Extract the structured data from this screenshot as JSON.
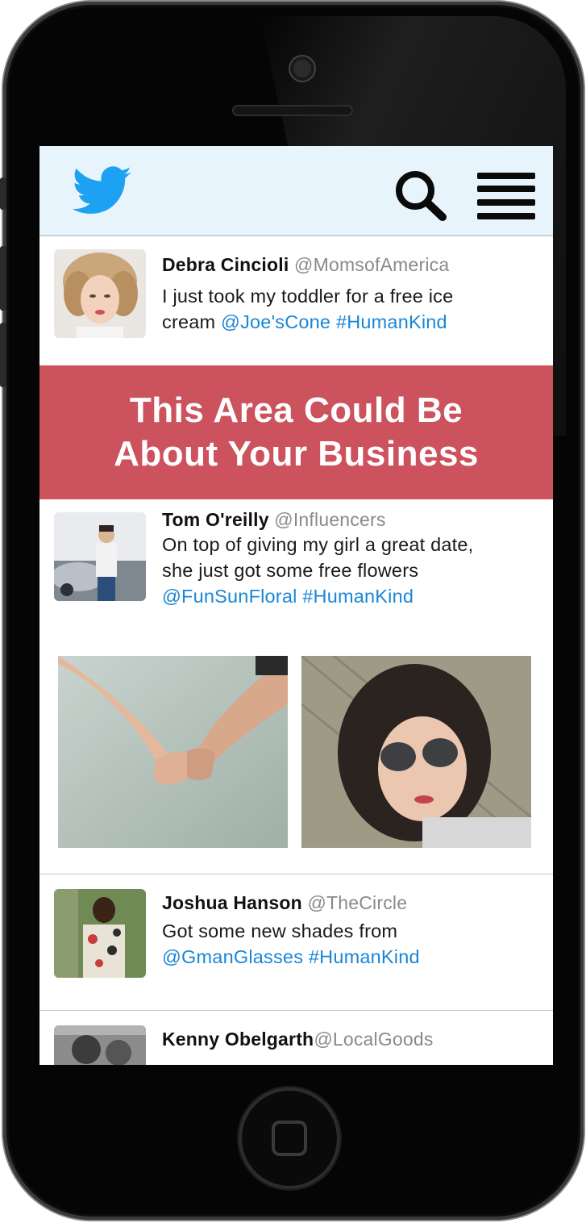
{
  "app": {
    "brand": "twitter",
    "icons": {
      "logo": "twitter-bird-icon",
      "search": "search-icon",
      "menu": "hamburger-menu-icon"
    },
    "colors": {
      "brand_blue": "#1da1f2",
      "header_bg": "#e8f4fb",
      "promo_bg": "#cc525e",
      "link": "#1a86d6",
      "handle": "#8a8a8a"
    }
  },
  "promo": {
    "line1": "This Area Could Be",
    "line2": "About Your Business"
  },
  "tweets": [
    {
      "name": "Debra Cincioli",
      "handle": "@MomsofAmerica",
      "text_line1": "I just took my toddler for a free ice",
      "text_line2_plain": "cream ",
      "mention": "@Joe'sCone",
      "hashtag": "#HumanKind"
    },
    {
      "name": "Tom O'reilly",
      "handle": "@Influencers",
      "text_line1": "On top of giving my girl a great date,",
      "text_line2": "she just got some free flowers",
      "mention": "@FunSunFloral",
      "hashtag": "#HumanKind"
    },
    {
      "name": "Joshua Hanson",
      "handle": "@TheCircle",
      "text_line1": "Got some new shades from",
      "mention": "@GmanGlasses",
      "hashtag": "#HumanKind"
    },
    {
      "name": "Kenny Obelgarth",
      "handle": "@LocalGoods"
    }
  ]
}
